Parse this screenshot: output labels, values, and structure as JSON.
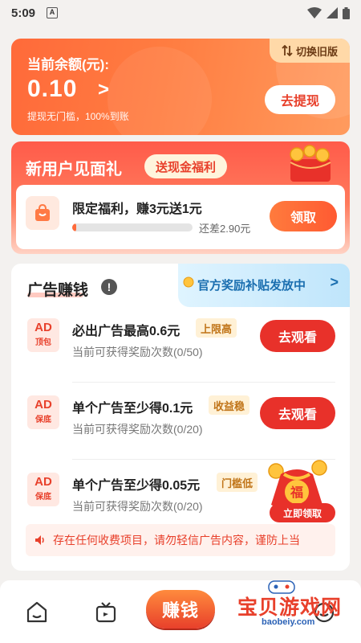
{
  "status_bar": {
    "time": "5:09",
    "notification_glyph": "A"
  },
  "balance_card": {
    "label": "当前余额(元):",
    "amount": "0.10",
    "amount_chevron": ">",
    "subtitle": "提现无门槛，100%到账",
    "switch_label": "切换旧版",
    "withdraw_label": "去提现"
  },
  "new_user": {
    "title": "新用户见面礼",
    "tag": "送现金福利",
    "task_title": "限定福利，赚3元送1元",
    "progress_fraction": 0.033,
    "remaining": "还差2.90元",
    "claim_label": "领取"
  },
  "ad_section": {
    "title": "广告赚钱",
    "info_glyph": "!",
    "banner_text": "官方奖励补贴发放中",
    "banner_chevron": ">",
    "watch_label": "去观看",
    "rows": [
      {
        "badge_top": "AD",
        "badge_bottom": "顶包",
        "name": "必出广告最高0.6元",
        "tag": "上限高",
        "count": "当前可获得奖励次数(0/50)",
        "button": "去观看"
      },
      {
        "badge_top": "AD",
        "badge_bottom": "保底",
        "name": "单个广告至少得0.1元",
        "tag": "收益稳",
        "count": "当前可获得奖励次数(0/20)",
        "button": "去观看"
      },
      {
        "badge_top": "AD",
        "badge_bottom": "保底",
        "name": "单个广告至少得0.05元",
        "tag": "门槛低",
        "count": "当前可获得奖励次数(0/20)"
      }
    ],
    "notice": "存在任何收费项目，请勿轻信广告内容，谨防上当",
    "float_label": "立即领取",
    "float_glyph": "福"
  },
  "bottom_nav": {
    "earn_label": "赚钱"
  },
  "watermark": {
    "main": "宝贝游戏网",
    "url": "baobeiy.com"
  },
  "colors": {
    "accent": "#e8312a",
    "orange": "#ff6a3a",
    "banner_blue": "#1b6fb0"
  }
}
